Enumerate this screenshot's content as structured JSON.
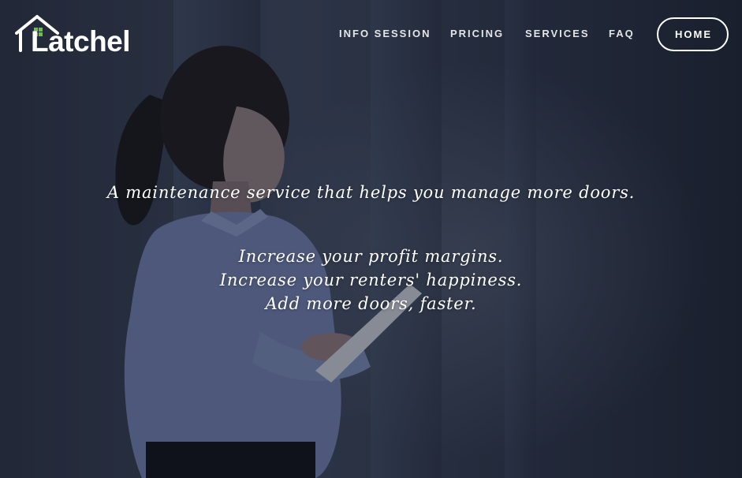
{
  "brand": {
    "name": "Latchel",
    "logo_icon": "house-icon",
    "accent_color": "#6cc04a"
  },
  "nav": {
    "items": [
      {
        "label": "INFO SESSION"
      },
      {
        "label": "PRICING"
      },
      {
        "label": "SERVICES"
      },
      {
        "label": "FAQ"
      }
    ],
    "home_button": "HOME"
  },
  "hero": {
    "tagline": "A maintenance service that helps you manage more doors.",
    "benefits": [
      "Increase your profit margins.",
      "Increase your renters' happiness.",
      "Add more doors, faster."
    ]
  }
}
